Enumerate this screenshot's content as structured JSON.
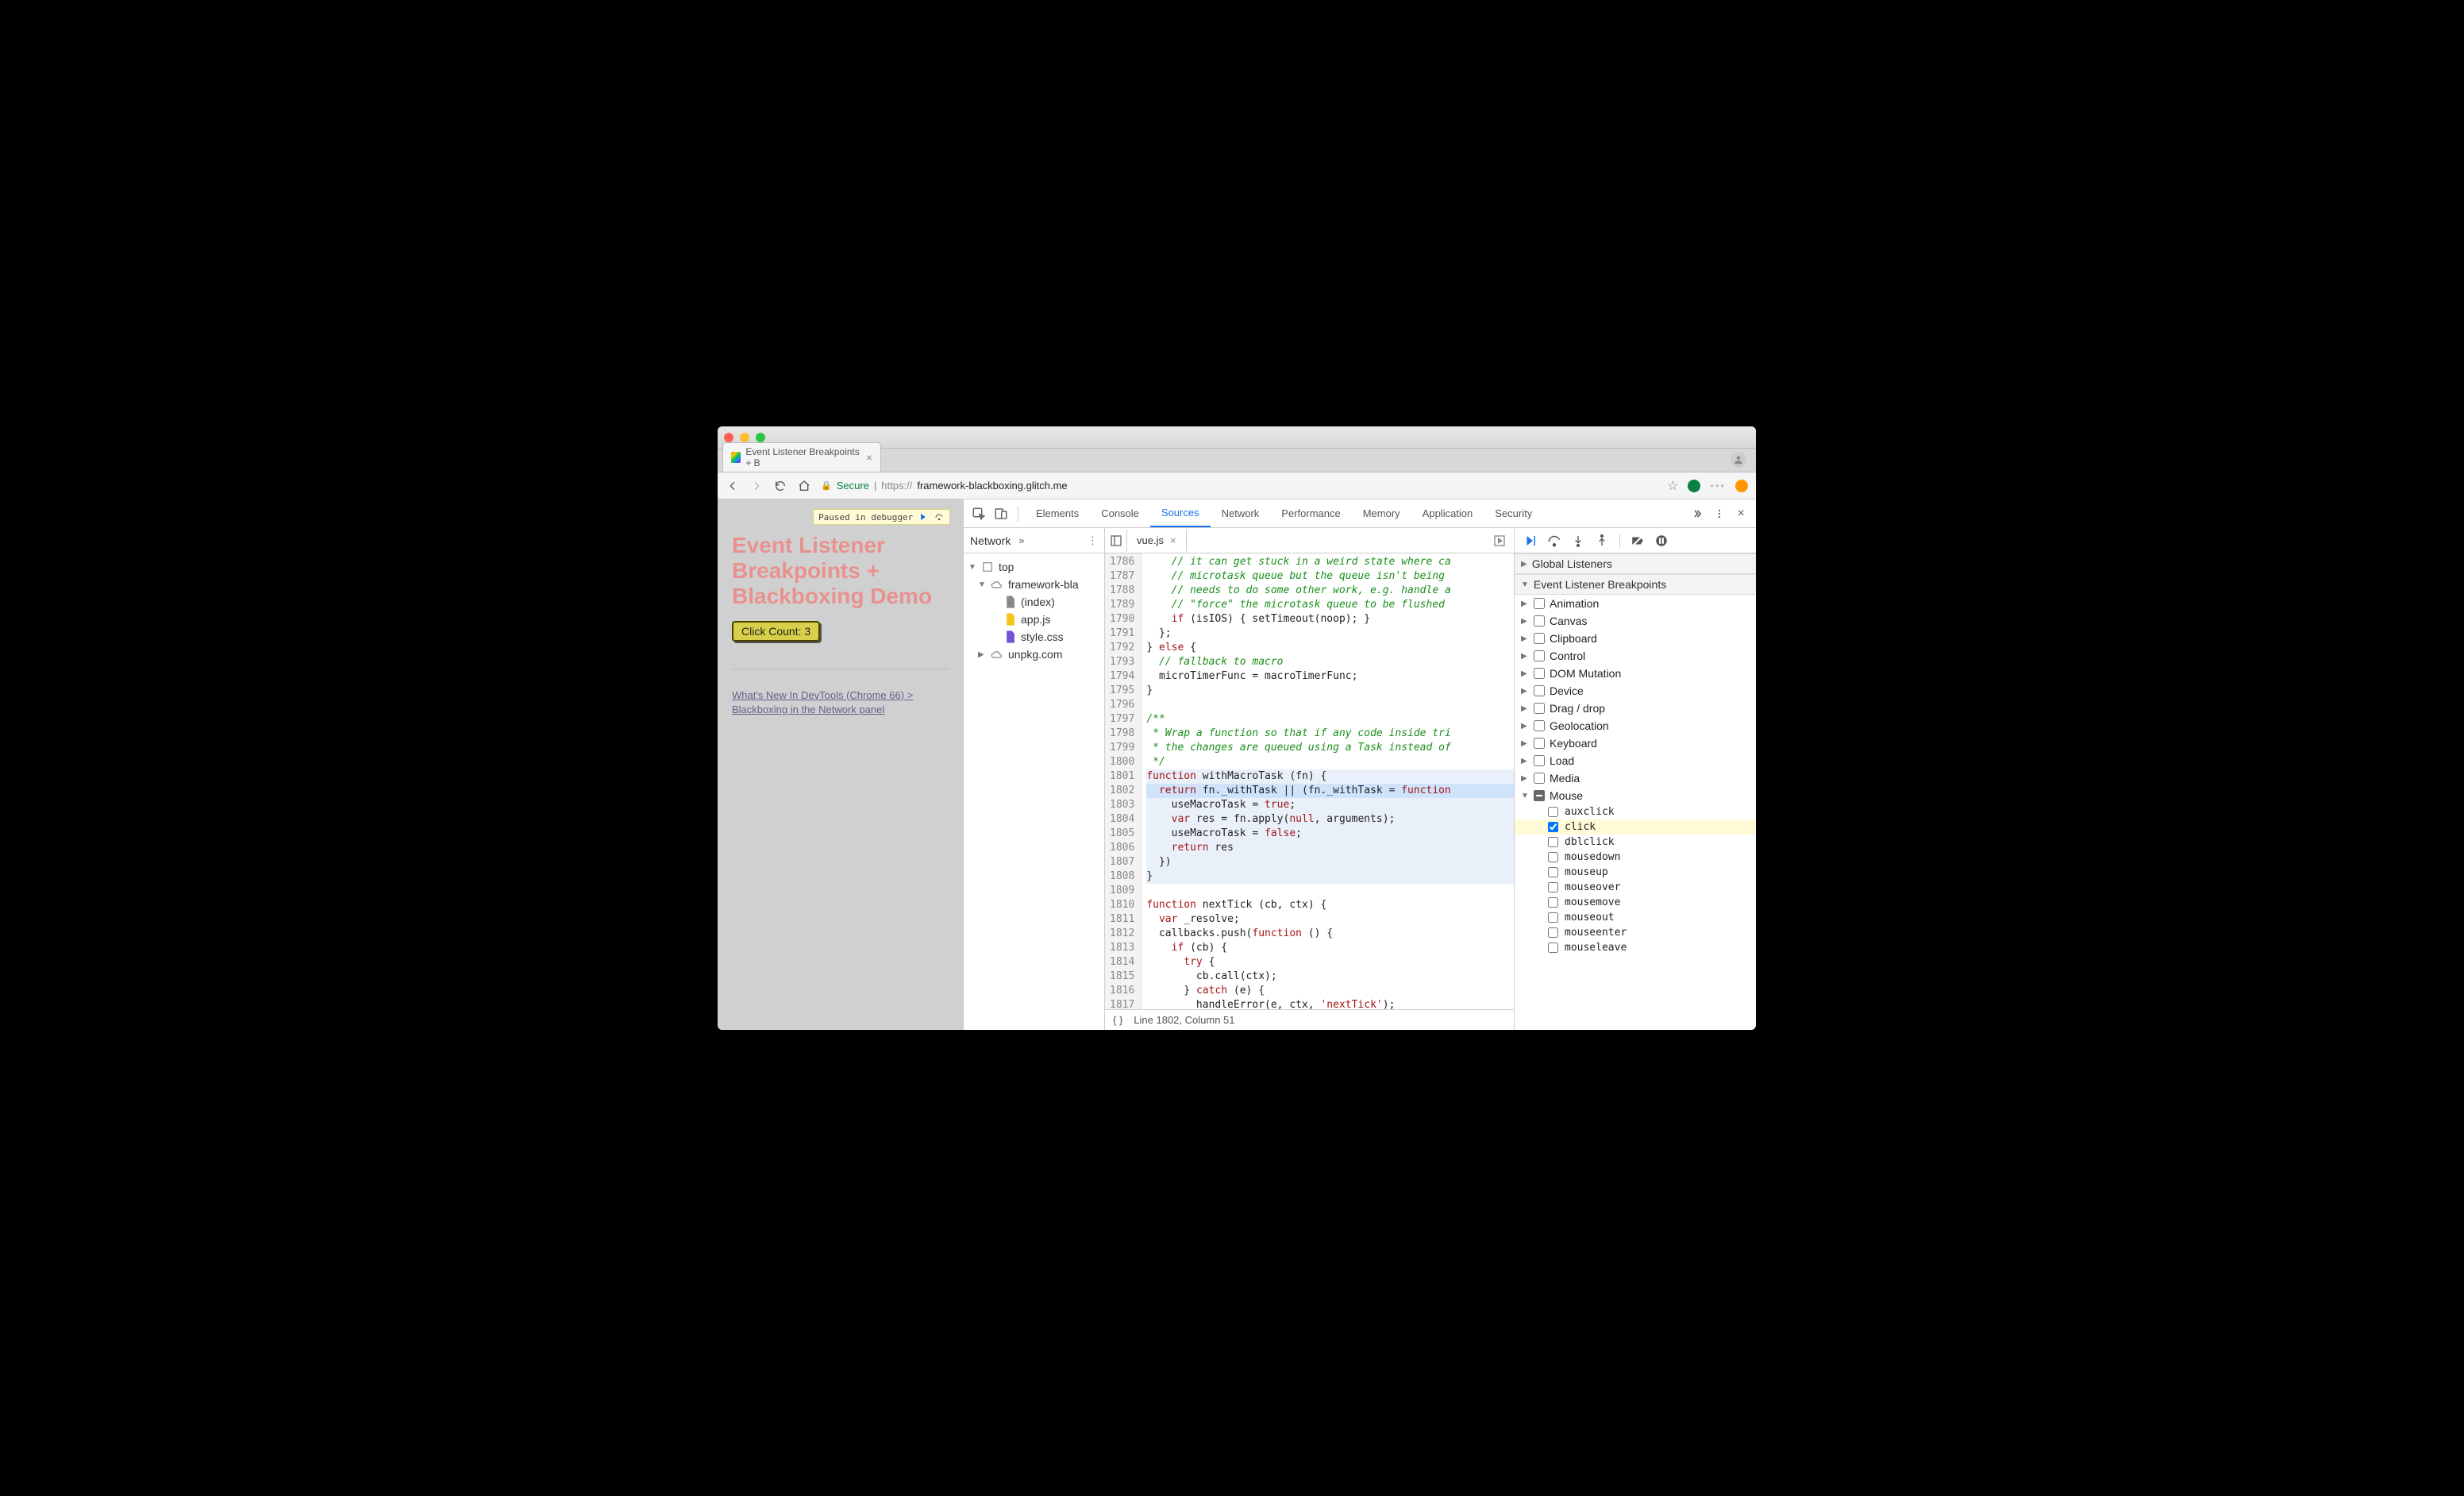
{
  "browser": {
    "tab_title": "Event Listener Breakpoints + B",
    "secure_label": "Secure",
    "url_prefix": "https://",
    "url_host": "framework-blackboxing.glitch.me"
  },
  "page": {
    "paused_label": "Paused in debugger",
    "title": "Event Listener Breakpoints + Blackboxing Demo",
    "click_btn": "Click Count: 3",
    "link_text": "What's New In DevTools (Chrome 66) > Blackboxing in the Network panel"
  },
  "devtools": {
    "tabs": [
      "Elements",
      "Console",
      "Sources",
      "Network",
      "Performance",
      "Memory",
      "Application",
      "Security"
    ],
    "active_tab": "Sources",
    "left_panel_tab": "Network",
    "tree": {
      "top": "top",
      "domain": "framework-bla",
      "files": [
        "(index)",
        "app.js",
        "style.css"
      ],
      "cdn": "unpkg.com"
    },
    "file_tab": "vue.js",
    "status": "Line 1802, Column 51",
    "code": {
      "start": 1786,
      "highlight_range": [
        1801,
        1808
      ],
      "current": 1802,
      "lines": [
        "    // it can get stuck in a weird state where ca",
        "    // microtask queue but the queue isn't being ",
        "    // needs to do some other work, e.g. handle a",
        "    // \"force\" the microtask queue to be flushed ",
        "    if (isIOS) { setTimeout(noop); }",
        "  };",
        "} else {",
        "  // fallback to macro",
        "  microTimerFunc = macroTimerFunc;",
        "}",
        "",
        "/**",
        " * Wrap a function so that if any code inside tri",
        " * the changes are queued using a Task instead of",
        " */",
        "function withMacroTask (fn) {",
        "  return fn._withTask || (fn._withTask = function",
        "    useMacroTask = true;",
        "    var res = fn.apply(null, arguments);",
        "    useMacroTask = false;",
        "    return res",
        "  })",
        "} ",
        "",
        "function nextTick (cb, ctx) {",
        "  var _resolve;",
        "  callbacks.push(function () {",
        "    if (cb) {",
        "      try {",
        "        cb.call(ctx);",
        "      } catch (e) {",
        "        handleError(e, ctx, 'nextTick');",
        "      }"
      ]
    },
    "right": {
      "global_listeners": "Global Listeners",
      "elb": "Event Listener Breakpoints",
      "categories": [
        "Animation",
        "Canvas",
        "Clipboard",
        "Control",
        "DOM Mutation",
        "Device",
        "Drag / drop",
        "Geolocation",
        "Keyboard",
        "Load",
        "Media",
        "Mouse"
      ],
      "expanded": "Mouse",
      "mouse_events": [
        "auxclick",
        "click",
        "dblclick",
        "mousedown",
        "mouseup",
        "mouseover",
        "mousemove",
        "mouseout",
        "mouseenter",
        "mouseleave"
      ],
      "checked_event": "click"
    }
  }
}
